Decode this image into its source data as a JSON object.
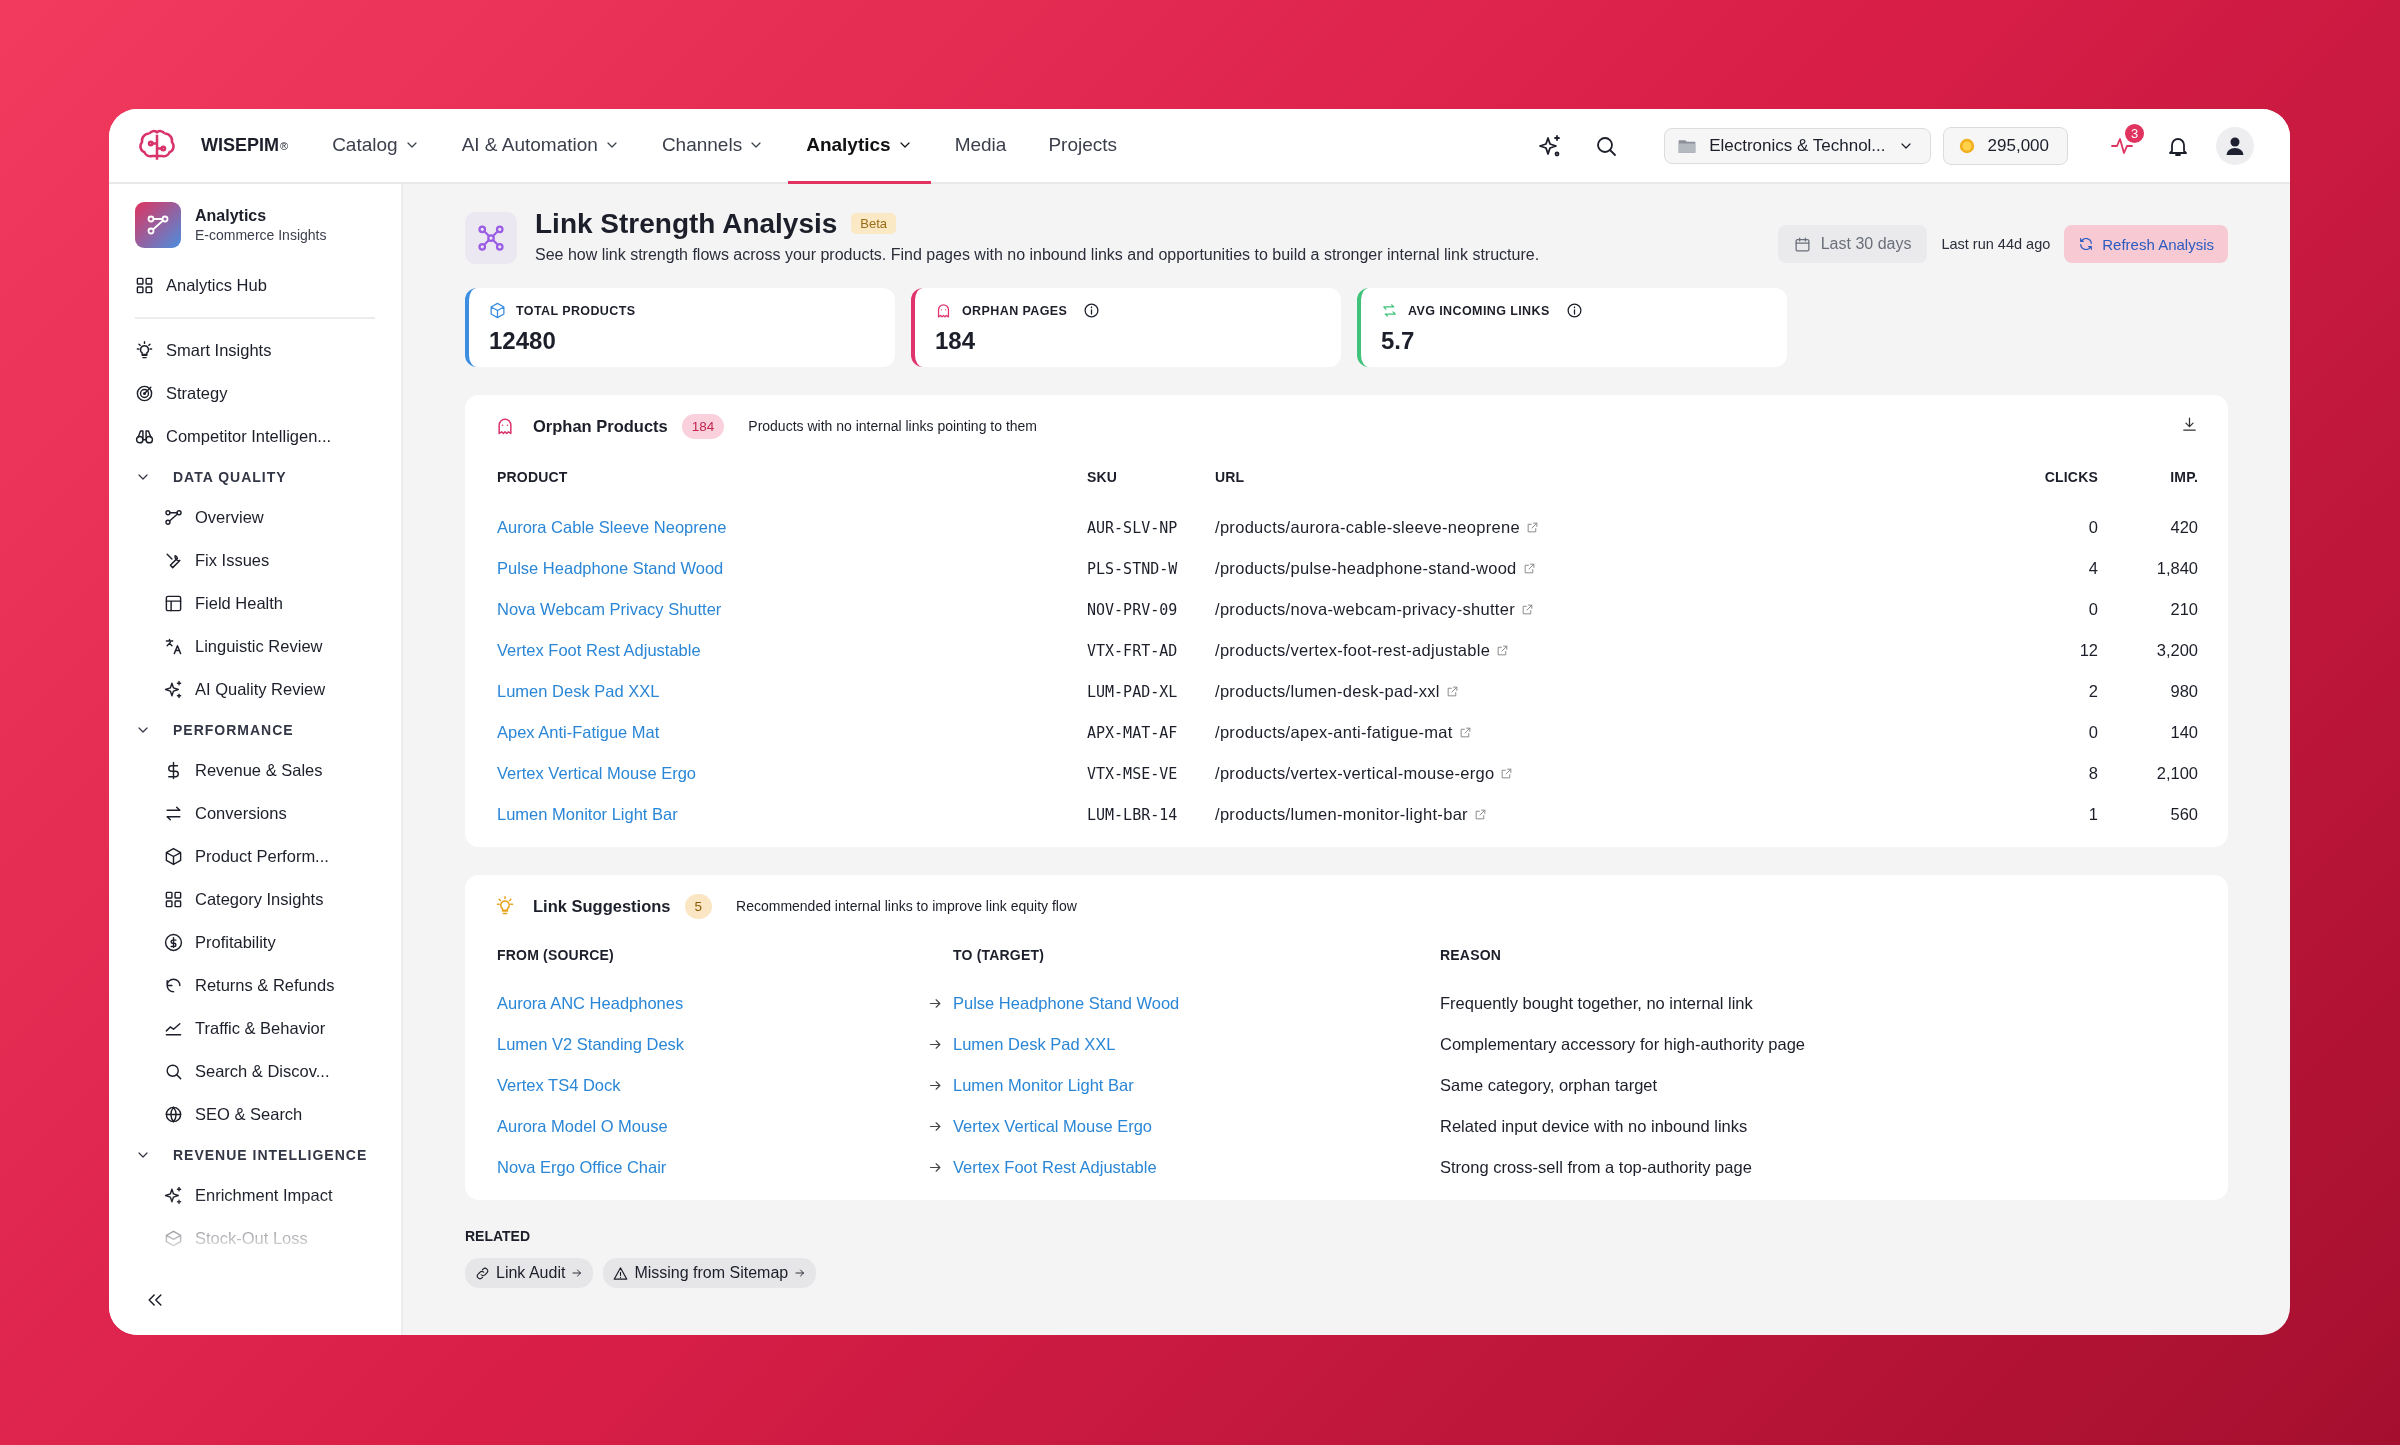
{
  "header": {
    "brand": "WISEPIM",
    "brand_mark": "®",
    "nav": [
      {
        "label": "Catalog",
        "dropdown": true,
        "selected": false
      },
      {
        "label": "AI & Automation",
        "dropdown": true,
        "selected": false
      },
      {
        "label": "Channels",
        "dropdown": true,
        "selected": false
      },
      {
        "label": "Analytics",
        "dropdown": true,
        "selected": true
      },
      {
        "label": "Media",
        "dropdown": false,
        "selected": false
      },
      {
        "label": "Projects",
        "dropdown": false,
        "selected": false
      }
    ],
    "workspace": "Electronics & Technol...",
    "credits": "295,000",
    "alerts_badge": "3"
  },
  "sidebar": {
    "app_title": "Analytics",
    "app_subtitle": "E-commerce Insights",
    "hub": "Analytics Hub",
    "items": [
      {
        "label": "Smart Insights"
      },
      {
        "label": "Strategy"
      },
      {
        "label": "Competitor Intelligen..."
      }
    ],
    "sections": [
      {
        "title": "DATA QUALITY",
        "expanded": true,
        "items": [
          {
            "label": "Overview"
          },
          {
            "label": "Fix Issues"
          },
          {
            "label": "Field Health"
          },
          {
            "label": "Linguistic Review"
          },
          {
            "label": "AI Quality Review"
          }
        ]
      },
      {
        "title": "PERFORMANCE",
        "expanded": true,
        "items": [
          {
            "label": "Revenue & Sales"
          },
          {
            "label": "Conversions"
          },
          {
            "label": "Product Perform..."
          },
          {
            "label": "Category Insights"
          },
          {
            "label": "Profitability"
          },
          {
            "label": "Returns & Refunds"
          },
          {
            "label": "Traffic & Behavior"
          },
          {
            "label": "Search & Discov..."
          },
          {
            "label": "SEO & Search"
          }
        ]
      },
      {
        "title": "REVENUE INTELLIGENCE",
        "expanded": true,
        "items": [
          {
            "label": "Enrichment Impact"
          },
          {
            "label": "Stock-Out Loss"
          }
        ]
      }
    ]
  },
  "page": {
    "title": "Link Strength Analysis",
    "badge": "Beta",
    "description": "See how link strength flows across your products. Find pages with no inbound links and opportunities to build a stronger internal link structure.",
    "date_range": "Last 30 days",
    "last_run": "Last run 44d ago",
    "refresh": "Refresh Analysis"
  },
  "stats": [
    {
      "label": "TOTAL PRODUCTS",
      "value": "12480",
      "info": false,
      "color": "#3b8ee0"
    },
    {
      "label": "ORPHAN PAGES",
      "value": "184",
      "info": true,
      "color": "#e0336b"
    },
    {
      "label": "AVG INCOMING LINKS",
      "value": "5.7",
      "info": true,
      "color": "#3fc27a"
    }
  ],
  "orphans": {
    "title": "Orphan Products",
    "count": "184",
    "subtitle": "Products with no internal links pointing to them",
    "columns": [
      "PRODUCT",
      "SKU",
      "URL",
      "CLICKS",
      "IMP."
    ],
    "rows": [
      {
        "product": "Aurora Cable Sleeve Neoprene",
        "sku": "AUR-SLV-NP",
        "url": "/products/aurora-cable-sleeve-neoprene",
        "clicks": "0",
        "impressions": "420"
      },
      {
        "product": "Pulse Headphone Stand Wood",
        "sku": "PLS-STND-W",
        "url": "/products/pulse-headphone-stand-wood",
        "clicks": "4",
        "impressions": "1,840"
      },
      {
        "product": "Nova Webcam Privacy Shutter",
        "sku": "NOV-PRV-09",
        "url": "/products/nova-webcam-privacy-shutter",
        "clicks": "0",
        "impressions": "210"
      },
      {
        "product": "Vertex Foot Rest Adjustable",
        "sku": "VTX-FRT-AD",
        "url": "/products/vertex-foot-rest-adjustable",
        "clicks": "12",
        "impressions": "3,200"
      },
      {
        "product": "Lumen Desk Pad XXL",
        "sku": "LUM-PAD-XL",
        "url": "/products/lumen-desk-pad-xxl",
        "clicks": "2",
        "impressions": "980"
      },
      {
        "product": "Apex Anti-Fatigue Mat",
        "sku": "APX-MAT-AF",
        "url": "/products/apex-anti-fatigue-mat",
        "clicks": "0",
        "impressions": "140"
      },
      {
        "product": "Vertex Vertical Mouse Ergo",
        "sku": "VTX-MSE-VE",
        "url": "/products/vertex-vertical-mouse-ergo",
        "clicks": "8",
        "impressions": "2,100"
      },
      {
        "product": "Lumen Monitor Light Bar",
        "sku": "LUM-LBR-14",
        "url": "/products/lumen-monitor-light-bar",
        "clicks": "1",
        "impressions": "560"
      }
    ]
  },
  "suggestions": {
    "title": "Link Suggestions",
    "count": "5",
    "subtitle": "Recommended internal links to improve link equity flow",
    "columns": [
      "FROM (SOURCE)",
      "TO (TARGET)",
      "REASON"
    ],
    "rows": [
      {
        "from": "Aurora ANC Headphones",
        "to": "Pulse Headphone Stand Wood",
        "reason": "Frequently bought together, no internal link"
      },
      {
        "from": "Lumen V2 Standing Desk",
        "to": "Lumen Desk Pad XXL",
        "reason": "Complementary accessory for high-authority page"
      },
      {
        "from": "Vertex TS4 Dock",
        "to": "Lumen Monitor Light Bar",
        "reason": "Same category, orphan target"
      },
      {
        "from": "Aurora Model O Mouse",
        "to": "Vertex Vertical Mouse Ergo",
        "reason": "Related input device with no inbound links"
      },
      {
        "from": "Nova Ergo Office Chair",
        "to": "Vertex Foot Rest Adjustable",
        "reason": "Strong cross-sell from a top-authority page"
      }
    ]
  },
  "related": {
    "label": "RELATED",
    "links": [
      {
        "label": "Link Audit",
        "kind": "link"
      },
      {
        "label": "Missing from Sitemap",
        "kind": "warning"
      }
    ]
  }
}
